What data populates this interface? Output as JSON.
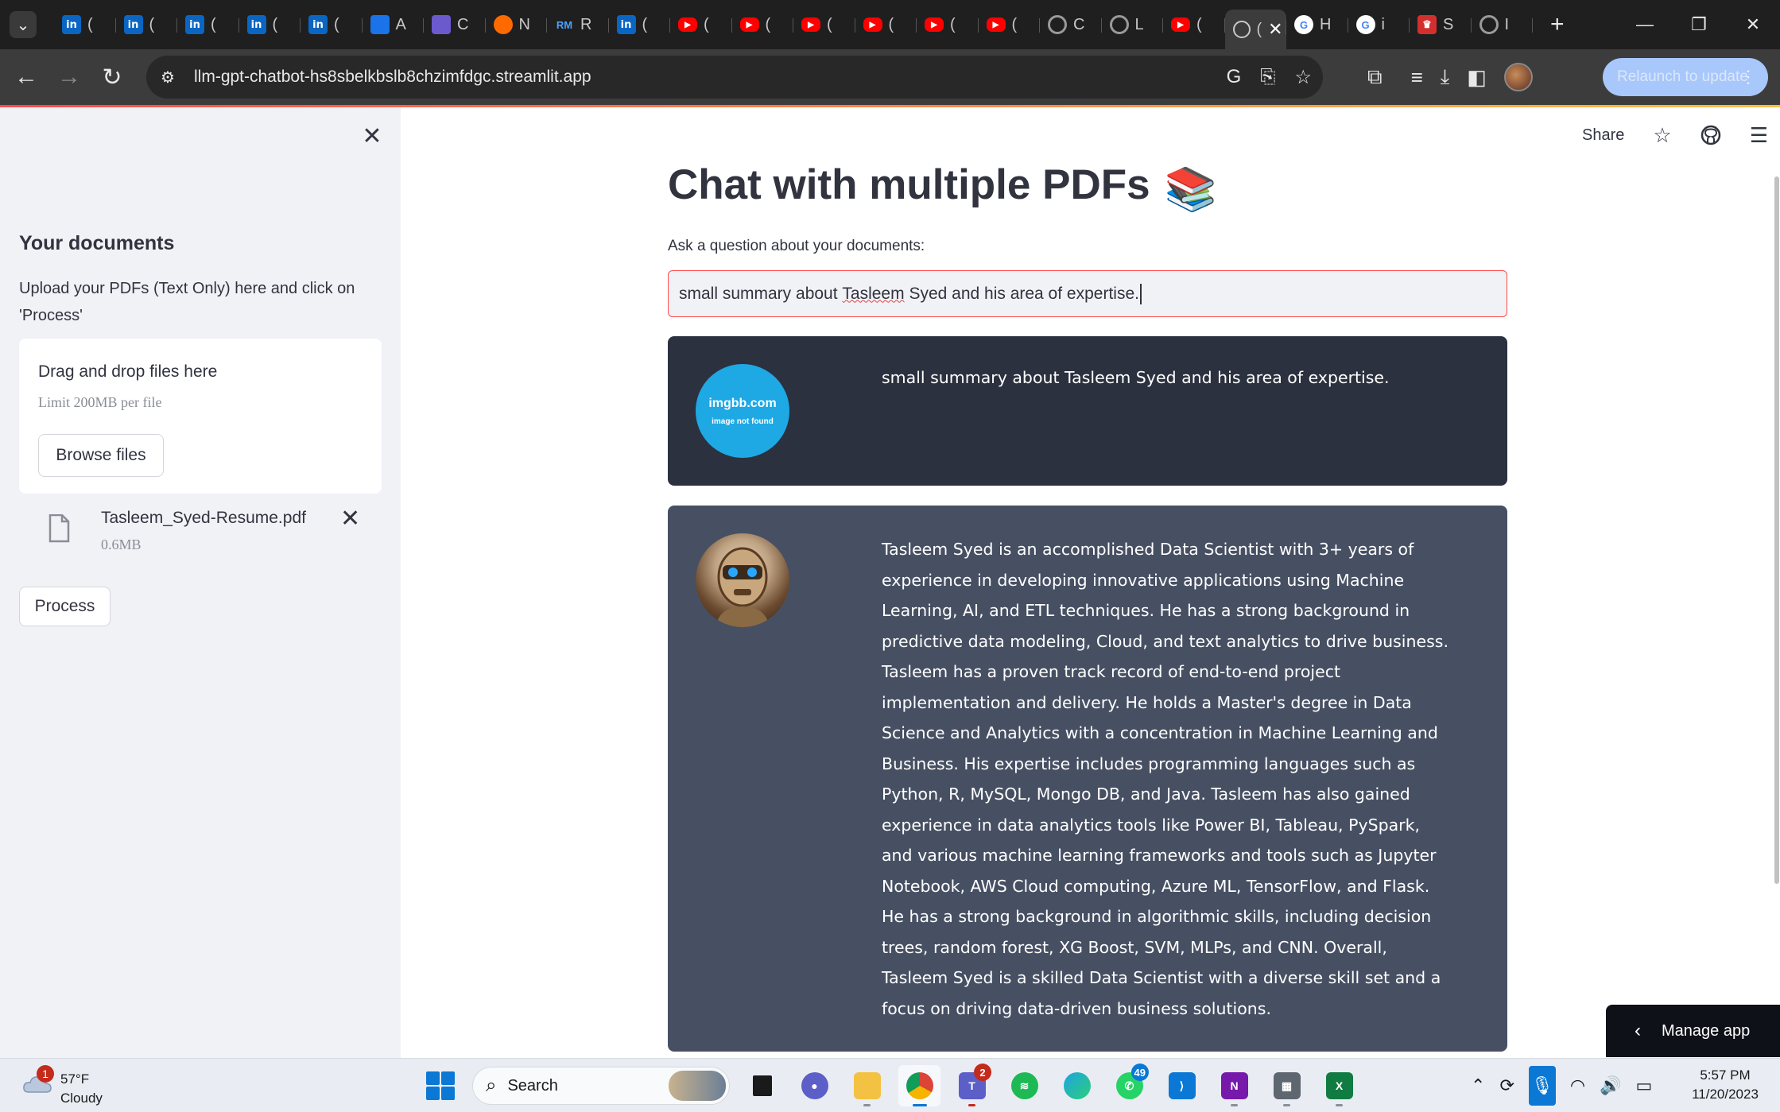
{
  "browser": {
    "tabs": [
      {
        "favicon": "linkedin-icon",
        "label": "(",
        "glyph": "in",
        "style": "fav-linkedin"
      },
      {
        "favicon": "linkedin-icon",
        "label": "(",
        "glyph": "in",
        "style": "fav-linkedin"
      },
      {
        "favicon": "linkedin-icon",
        "label": "(",
        "glyph": "in",
        "style": "fav-linkedin"
      },
      {
        "favicon": "linkedin-icon",
        "label": "(",
        "glyph": "in",
        "style": "fav-linkedin"
      },
      {
        "favicon": "linkedin-icon",
        "label": "(",
        "glyph": "in",
        "style": "fav-linkedin"
      },
      {
        "favicon": "arrow-logo-icon",
        "label": "A",
        "glyph": "",
        "style": "fav-blue"
      },
      {
        "favicon": "bird-logo-icon",
        "label": "C",
        "glyph": "",
        "style": "fav-purple"
      },
      {
        "favicon": "flower-logo-icon",
        "label": "N",
        "glyph": "",
        "style": "fav-orange"
      },
      {
        "favicon": "rm-logo-icon",
        "label": "R",
        "glyph": "RM",
        "style": "fav-rm"
      },
      {
        "favicon": "linkedin-icon",
        "label": "(",
        "glyph": "in",
        "style": "fav-linkedin"
      },
      {
        "favicon": "youtube-icon",
        "label": "(",
        "glyph": "▶",
        "style": "fav-youtube"
      },
      {
        "favicon": "youtube-icon",
        "label": "(",
        "glyph": "▶",
        "style": "fav-youtube"
      },
      {
        "favicon": "youtube-icon",
        "label": "(",
        "glyph": "▶",
        "style": "fav-youtube"
      },
      {
        "favicon": "youtube-icon",
        "label": "(",
        "glyph": "▶",
        "style": "fav-youtube"
      },
      {
        "favicon": "youtube-icon",
        "label": "(",
        "glyph": "▶",
        "style": "fav-youtube"
      },
      {
        "favicon": "youtube-icon",
        "label": "(",
        "glyph": "▶",
        "style": "fav-youtube"
      },
      {
        "favicon": "github-icon",
        "label": "C",
        "glyph": "",
        "style": "fav-github"
      },
      {
        "favicon": "github-icon",
        "label": "L",
        "glyph": "",
        "style": "fav-github"
      },
      {
        "favicon": "youtube-icon",
        "label": "(",
        "glyph": "▶",
        "style": "fav-youtube"
      },
      {
        "favicon": "streamlit-icon",
        "label": "(",
        "glyph": "",
        "style": "",
        "active": true
      },
      {
        "favicon": "google-icon",
        "label": "H",
        "glyph": "G",
        "style": "fav-google"
      },
      {
        "favicon": "google-icon",
        "label": "i",
        "glyph": "G",
        "style": "fav-google"
      },
      {
        "favicon": "crown-icon",
        "label": "S",
        "glyph": "♛",
        "style": "fav-red"
      },
      {
        "favicon": "github-icon",
        "label": "I",
        "glyph": "",
        "style": "fav-github"
      }
    ],
    "url": "llm-gpt-chatbot-hs8sbelkbslb8chzimfdgc.streamlit.app",
    "relaunch_label": "Relaunch to update"
  },
  "sidebar": {
    "heading": "Your documents",
    "help_text": "Upload your PDFs (Text Only) here and click on 'Process'",
    "dropzone_title": "Drag and drop files here",
    "dropzone_limit": "Limit 200MB per file",
    "browse_label": "Browse files",
    "file": {
      "name": "Tasleem_Syed-Resume.pdf",
      "size": "0.6MB"
    },
    "process_label": "Process"
  },
  "main": {
    "share_label": "Share",
    "title": "Chat with multiple PDFs",
    "title_emoji": "📚",
    "question_label": "Ask a question about your documents:",
    "question_value_pre": "small summary about ",
    "question_value_misspelled": "Tasleem",
    "question_value_post": " Syed and his area of expertise.",
    "user_avatar_brand": "imgbb.com",
    "user_avatar_sub": "image not found",
    "user_message": "small summary about Tasleem Syed and his area of expertise.",
    "bot_message": "Tasleem Syed is an accomplished Data Scientist with 3+ years of experience in developing innovative applications using Machine Learning, AI, and ETL techniques. He has a strong background in predictive data modeling, Cloud, and text analytics to drive business. Tasleem has a proven track record of end-to-end project implementation and delivery. He holds a Master's degree in Data Science and Analytics with a concentration in Machine Learning and Business. His expertise includes programming languages such as Python, R, MySQL, Mongo DB, and Java. Tasleem has also gained experience in data analytics tools like Power BI, Tableau, PySpark, and various machine learning frameworks and tools such as Jupyter Notebook, AWS Cloud computing, Azure ML, TensorFlow, and Flask. He has a strong background in algorithmic skills, including decision trees, random forest, XG Boost, SVM, MLPs, and CNN. Overall, Tasleem Syed is a skilled Data Scientist with a diverse skill set and a focus on driving data-driven business solutions.",
    "manage_app_label": "Manage app"
  },
  "taskbar": {
    "weather_badge": "1",
    "weather_temp": "57°F",
    "weather_condition": "Cloudy",
    "search_label": "Search",
    "teams_badge": "2",
    "whatsapp_badge": "49",
    "time": "5:57 PM",
    "date": "11/20/2023"
  },
  "colors": {
    "accent": "#ff4b4b",
    "sidebar_bg": "#f0f2f6",
    "user_msg_bg": "#2b313e",
    "bot_msg_bg": "#475063",
    "text": "#31333f"
  }
}
